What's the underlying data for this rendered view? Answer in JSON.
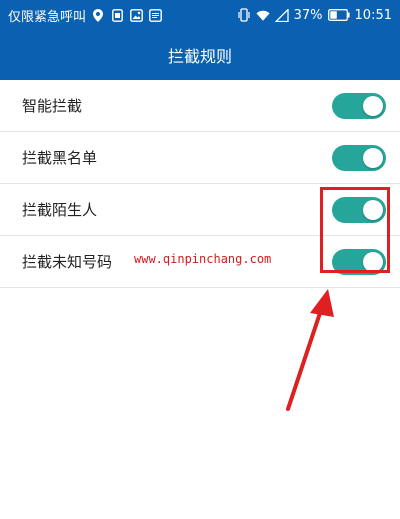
{
  "status_bar": {
    "carrier_text": "仅限紧急呼叫",
    "battery_percent": "37%",
    "time": "10:51"
  },
  "title_bar": {
    "title": "拦截规则"
  },
  "rules": [
    {
      "label": "智能拦截",
      "enabled": true
    },
    {
      "label": "拦截黑名单",
      "enabled": true
    },
    {
      "label": "拦截陌生人",
      "enabled": true
    },
    {
      "label": "拦截未知号码",
      "enabled": true
    }
  ],
  "watermark": {
    "text": "www.qinpinchang.com"
  },
  "colors": {
    "header_bg": "#0a61b1",
    "toggle_on": "#26a69a",
    "annotation_red": "#e02020"
  }
}
